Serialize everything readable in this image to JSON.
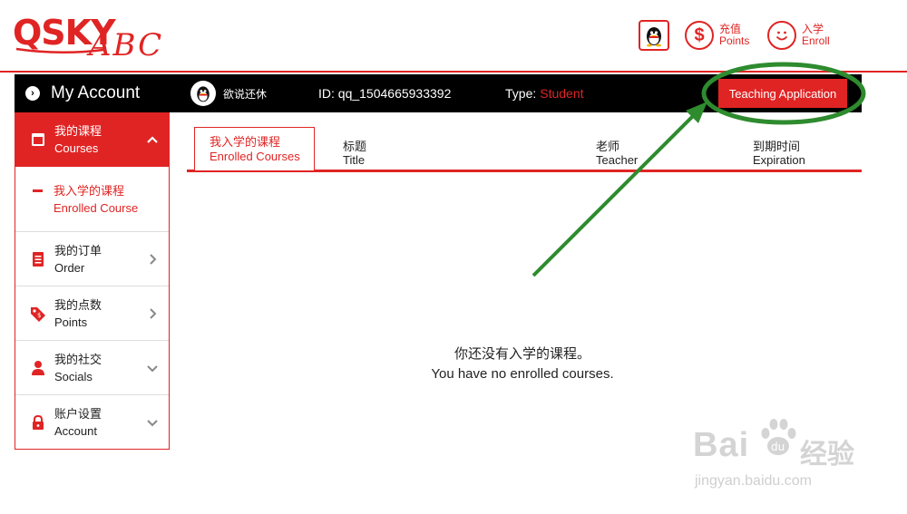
{
  "brand": {
    "logo_main": "QSKY",
    "logo_script": "ABC",
    "color": "#e02424"
  },
  "header": {
    "points": {
      "zh": "充值",
      "en": "Points",
      "icon": "dollar-icon"
    },
    "enroll": {
      "zh": "入学",
      "en": "Enroll",
      "icon": "smile-icon"
    }
  },
  "account_bar": {
    "title": "My Account",
    "username": "欲说还休",
    "id_text": "ID: qq_1504665933392",
    "type_label": "Type:",
    "type_value": "Student",
    "teach_button": "Teaching Application"
  },
  "sidebar": {
    "items": [
      {
        "zh": "我的课程",
        "en": "Courses",
        "icon": "courses-icon",
        "active": true,
        "chevron": "up"
      },
      {
        "zh": "我的订单",
        "en": "Order",
        "icon": "order-icon",
        "chevron": "right"
      },
      {
        "zh": "我的点数",
        "en": "Points",
        "icon": "tag-icon",
        "chevron": "right"
      },
      {
        "zh": "我的社交",
        "en": "Socials",
        "icon": "person-icon",
        "chevron": "down"
      },
      {
        "zh": "账户设置",
        "en": "Account",
        "icon": "lock-icon",
        "chevron": "down"
      }
    ],
    "subitem": {
      "zh": "我入学的课程",
      "en": "Enrolled Course"
    }
  },
  "main": {
    "tab": {
      "zh": "我入学的课程",
      "en": "Enrolled Courses"
    },
    "columns": [
      {
        "zh": "标题",
        "en": "Title"
      },
      {
        "zh": "老师",
        "en": "Teacher"
      },
      {
        "zh": "到期时间",
        "en": "Expiration"
      }
    ],
    "empty_zh": "你还没有入学的课程。",
    "empty_en": "You have no enrolled courses."
  },
  "annotation": {
    "color": "#2e8b2e"
  },
  "watermark": {
    "brand": "Bai",
    "brand_zh": "经验",
    "url": "jingyan.baidu.com"
  }
}
